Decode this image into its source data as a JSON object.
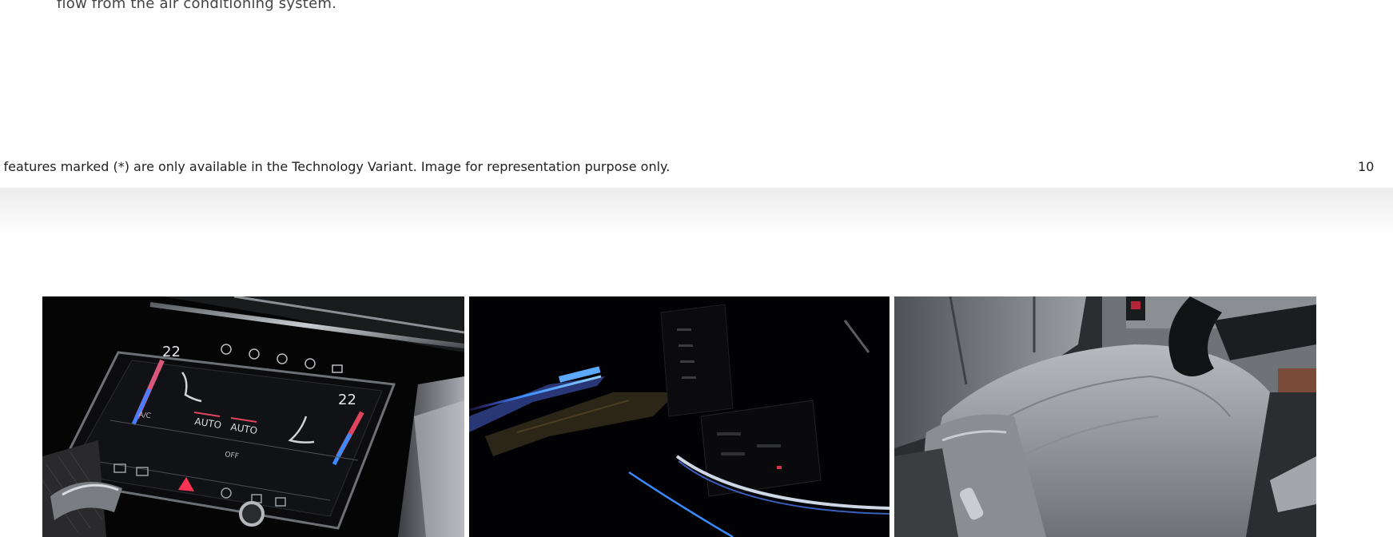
{
  "page": {
    "body_text": "flow from the air conditioning system.",
    "disclaimer": "l features marked (*) are only available in the Technology Variant. Image for representation purpose only.",
    "page_number": "10"
  },
  "climate_panel": {
    "left_temp": "22",
    "right_temp": "22",
    "auto_left": "AUTO",
    "auto_right": "AUTO",
    "ac_label": "A/C",
    "off_label": "OFF"
  },
  "colors": {
    "ambient_blue": "#3a8bff",
    "temp_red": "#e0455e",
    "hazard_red": "#ff3355",
    "seat_grey": "#8a8d92"
  },
  "icons": [
    "seat-heating-icon",
    "fan-icon",
    "hazard-icon",
    "ac-icon"
  ]
}
